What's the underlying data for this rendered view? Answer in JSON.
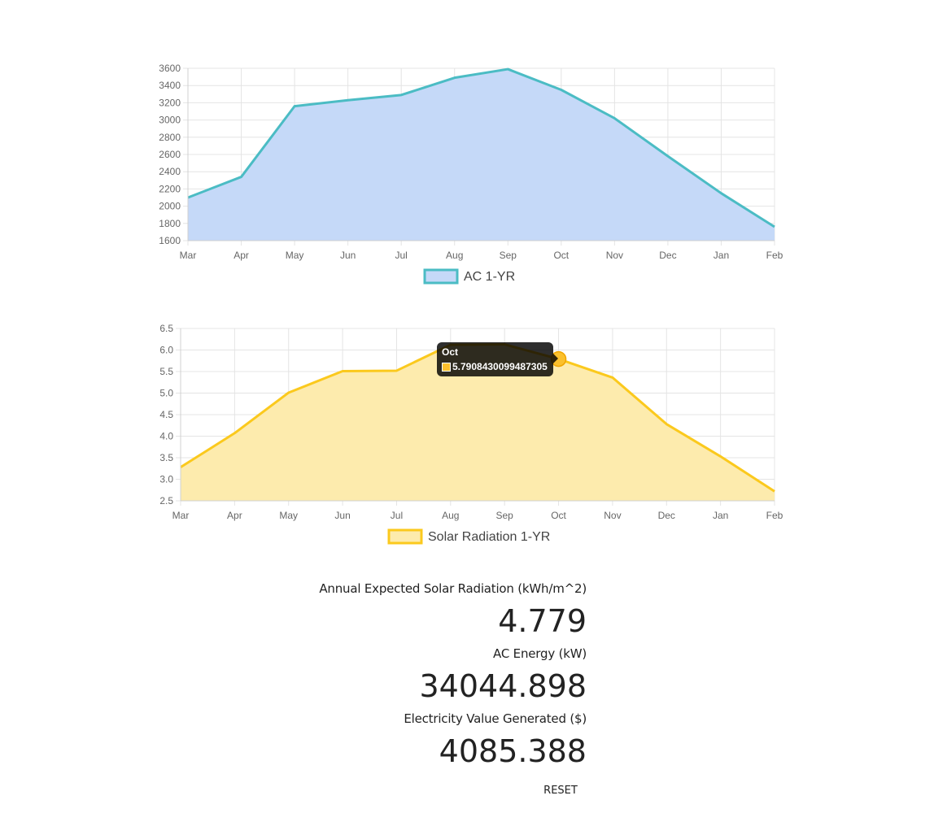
{
  "chart_data": [
    {
      "type": "area",
      "categories": [
        "Mar",
        "Apr",
        "May",
        "Jun",
        "Jul",
        "Aug",
        "Sep",
        "Oct",
        "Nov",
        "Dec",
        "Jan",
        "Feb"
      ],
      "series": [
        {
          "name": "AC 1-YR",
          "values": [
            2100,
            2340,
            3160,
            3230,
            3290,
            3490,
            3590,
            3350,
            3020,
            2580,
            2150,
            1760
          ],
          "line_color": "#4bbcc4",
          "fill_color": "#c5d9f8"
        }
      ],
      "y_ticks": [
        "3600",
        "3400",
        "3200",
        "3000",
        "2800",
        "2600",
        "2400",
        "2200",
        "2000",
        "1800",
        "1600"
      ],
      "ylim": [
        1600,
        3600
      ],
      "grid": true,
      "legend_position": "bottom"
    },
    {
      "type": "area",
      "categories": [
        "Mar",
        "Apr",
        "May",
        "Jun",
        "Jul",
        "Aug",
        "Sep",
        "Oct",
        "Nov",
        "Dec",
        "Jan",
        "Feb"
      ],
      "series": [
        {
          "name": "Solar Radiation 1-YR",
          "values": [
            3.28,
            4.07,
            5.01,
            5.51,
            5.52,
            6.12,
            6.13,
            5.7908430099487305,
            5.36,
            4.28,
            3.53,
            2.72
          ],
          "line_color": "#fbc91d",
          "fill_color": "#fdebad"
        }
      ],
      "y_ticks": [
        "6.5",
        "6.0",
        "5.5",
        "5.0",
        "4.5",
        "4.0",
        "3.5",
        "3.0",
        "2.5"
      ],
      "ylim": [
        2.5,
        6.5
      ],
      "grid": true,
      "legend_position": "bottom"
    }
  ],
  "tooltip": {
    "title": "Oct",
    "value": "5.7908430099487305",
    "index": 7
  },
  "stats": [
    {
      "label": "Annual Expected Solar Radiation (kWh/m^2)",
      "value": "4.779"
    },
    {
      "label": "AC Energy (kW)",
      "value": "34044.898"
    },
    {
      "label": "Electricity Value Generated ($)",
      "value": "4085.388"
    }
  ],
  "reset_label": "RESET"
}
